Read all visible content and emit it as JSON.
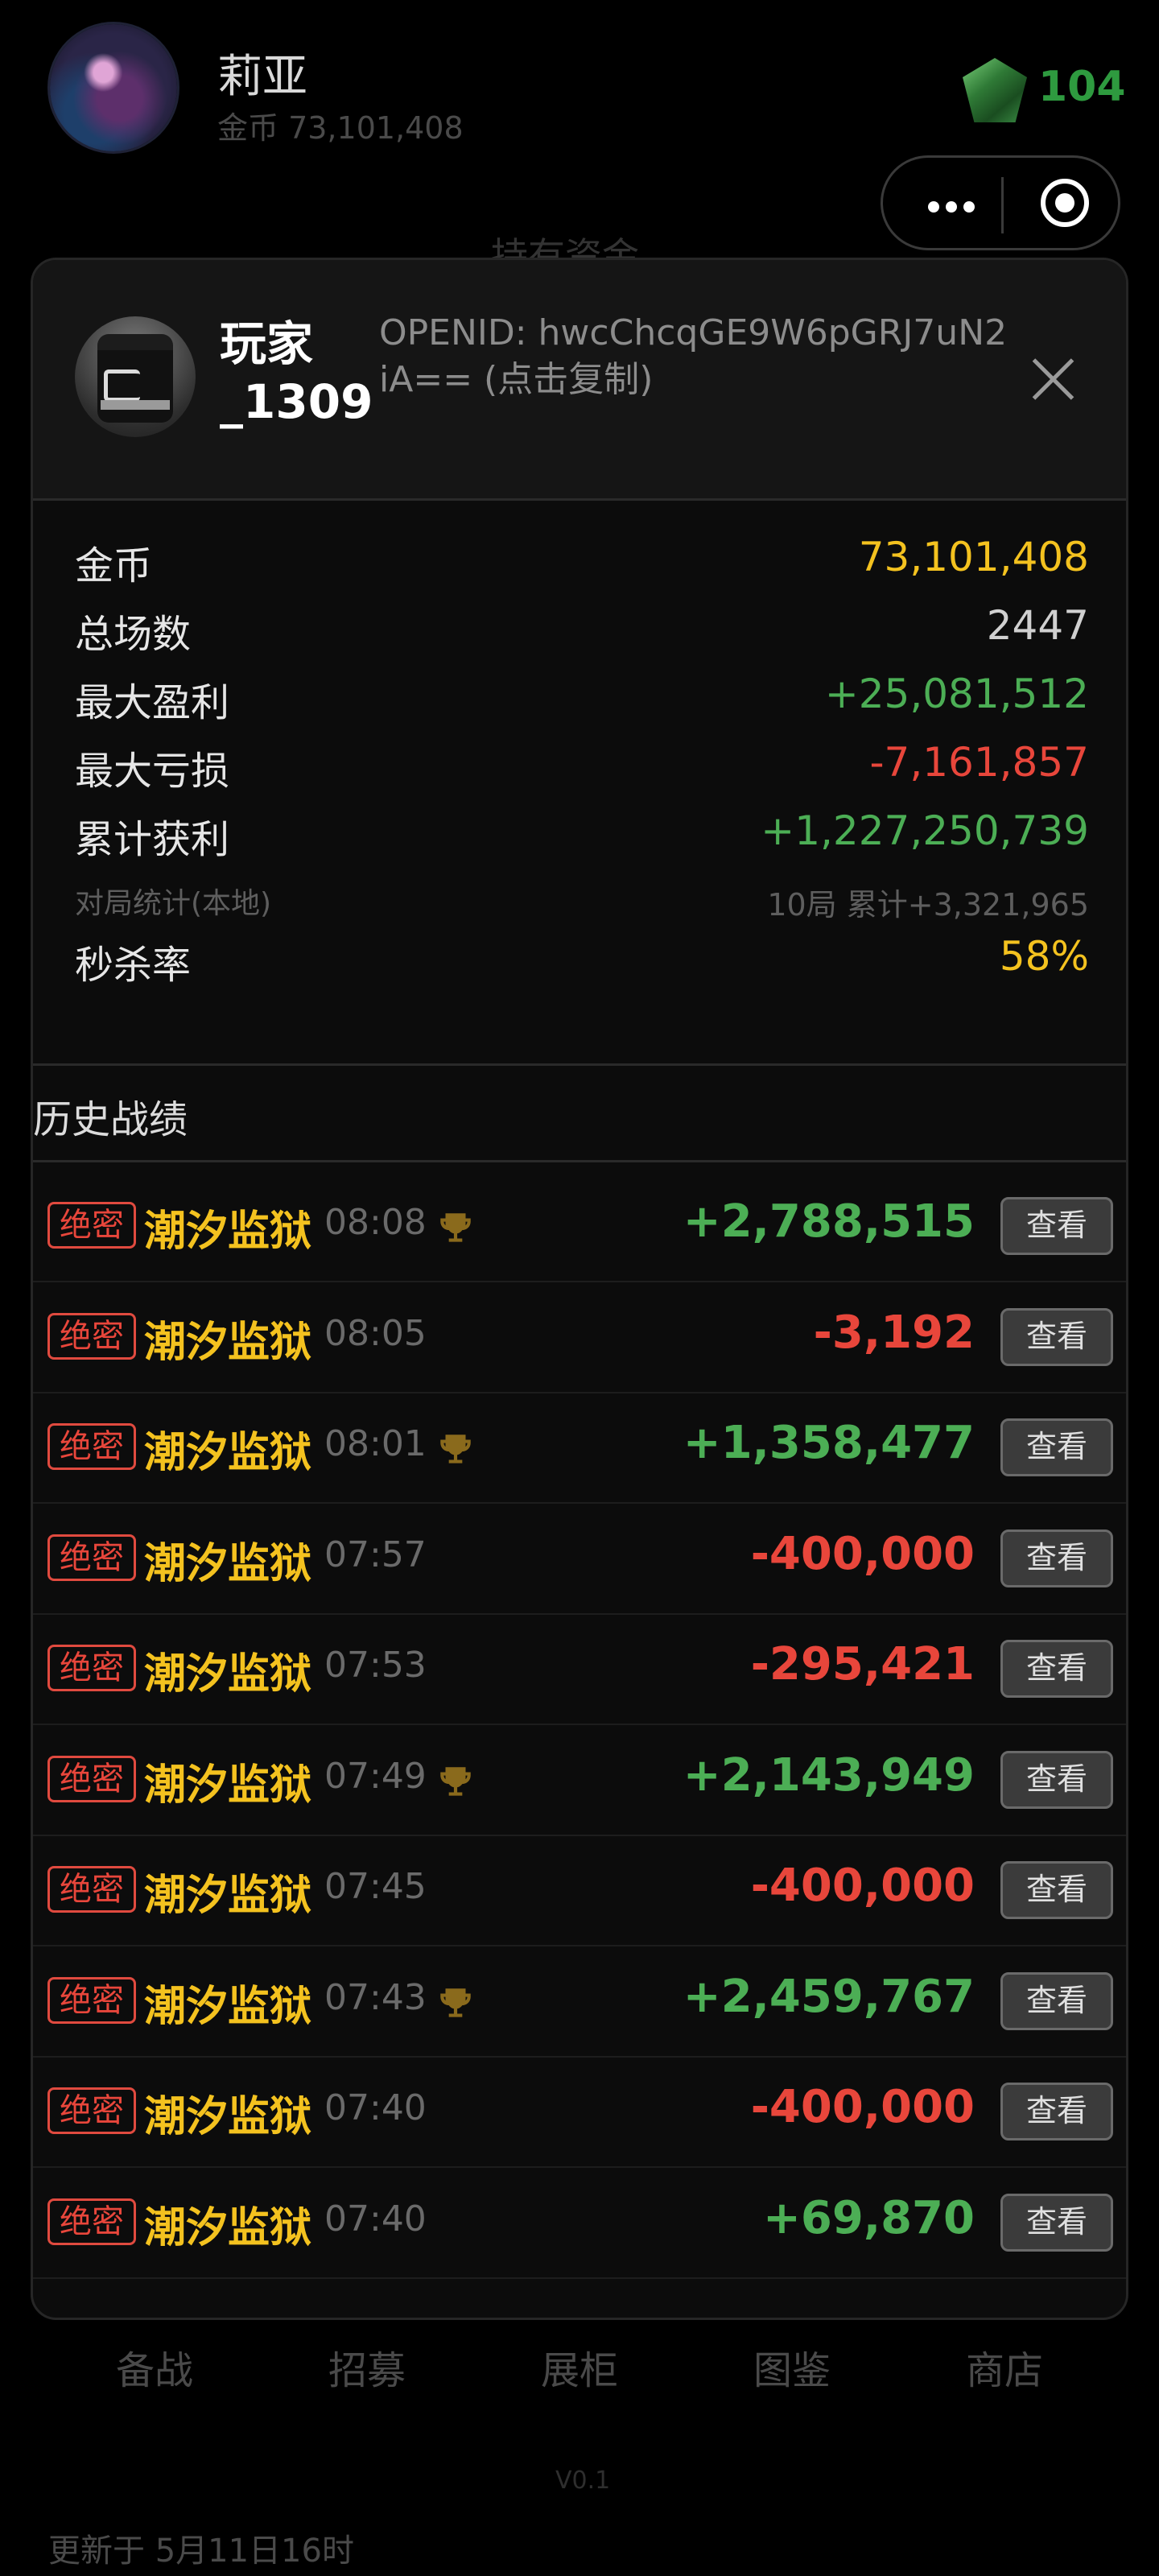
{
  "user": {
    "name": "莉亚",
    "coins_text": "金币 73,101,408",
    "gems": "104"
  },
  "background": {
    "holdings_title": "持有资金",
    "nav": [
      "备战",
      "招募",
      "展柜",
      "图鉴",
      "商店"
    ],
    "version": "V0.1",
    "updated": "更新于 5月11日16时"
  },
  "modal": {
    "player_name": "玩家_1309",
    "openid_text": "OPENID: hwcChcqGE9W6pGRJ7uN2iA== (点击复制)",
    "stats": {
      "coins_label": "金币",
      "coins_value": "73,101,408",
      "games_label": "总场数",
      "games_value": "2447",
      "max_profit_label": "最大盈利",
      "max_profit_value": "+25,081,512",
      "max_loss_label": "最大亏损",
      "max_loss_value": "-7,161,857",
      "total_profit_label": "累计获利",
      "total_profit_value": "+1,227,250,739",
      "local_label": "对局统计(本地)",
      "local_value": "10局 累计+3,321,965",
      "kill_rate_label": "秒杀率",
      "kill_rate_value": "58%"
    },
    "history_title": "历史战绩",
    "view_label": "查看",
    "matches": [
      {
        "mode": "绝密",
        "map": "潮汐监狱",
        "time": "08:08",
        "trophy": true,
        "profit": "+2,788,515"
      },
      {
        "mode": "绝密",
        "map": "潮汐监狱",
        "time": "08:05",
        "trophy": false,
        "profit": "-3,192"
      },
      {
        "mode": "绝密",
        "map": "潮汐监狱",
        "time": "08:01",
        "trophy": true,
        "profit": "+1,358,477"
      },
      {
        "mode": "绝密",
        "map": "潮汐监狱",
        "time": "07:57",
        "trophy": false,
        "profit": "-400,000"
      },
      {
        "mode": "绝密",
        "map": "潮汐监狱",
        "time": "07:53",
        "trophy": false,
        "profit": "-295,421"
      },
      {
        "mode": "绝密",
        "map": "潮汐监狱",
        "time": "07:49",
        "trophy": true,
        "profit": "+2,143,949"
      },
      {
        "mode": "绝密",
        "map": "潮汐监狱",
        "time": "07:45",
        "trophy": false,
        "profit": "-400,000"
      },
      {
        "mode": "绝密",
        "map": "潮汐监狱",
        "time": "07:43",
        "trophy": true,
        "profit": "+2,459,767"
      },
      {
        "mode": "绝密",
        "map": "潮汐监狱",
        "time": "07:40",
        "trophy": false,
        "profit": "-400,000"
      },
      {
        "mode": "绝密",
        "map": "潮汐监狱",
        "time": "07:40",
        "trophy": false,
        "profit": "+69,870"
      }
    ]
  },
  "colors": {
    "gold": "#f4c21f",
    "positive": "#4cae55",
    "negative": "#e8463b",
    "neutral": "#d0d0d0",
    "gem_count": "#2e9a3f"
  },
  "icons": [
    "gem-icon",
    "more-dots-icon",
    "target-icon",
    "close-icon",
    "trophy-icon"
  ]
}
